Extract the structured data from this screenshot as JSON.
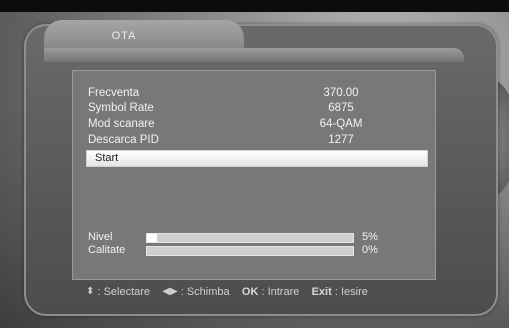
{
  "window": {
    "title": "OTA"
  },
  "fields": [
    {
      "label": "Frecventa",
      "value": "370.00"
    },
    {
      "label": "Symbol Rate",
      "value": "6875"
    },
    {
      "label": "Mod scanare",
      "value": "64-QAM"
    },
    {
      "label": "Descarca PID",
      "value": "1277"
    }
  ],
  "start": {
    "label": "Start"
  },
  "meters": {
    "nivel": {
      "label": "Nivel",
      "value_text": "5%",
      "level_percent": 5
    },
    "calitate": {
      "label": "Calitate",
      "value_text": "0%",
      "level_percent": 0
    }
  },
  "footer": {
    "select_icon": "up-down-arrows-icon",
    "select_label": ": Selectare",
    "change_icon": "left-right-arrows-icon",
    "change_label": ": Schimba",
    "ok_key": "OK",
    "ok_label": ": Intrare",
    "exit_key": "Exit",
    "exit_label": ": Iesire"
  },
  "colors": {
    "panel": "#787878",
    "highlight": "#ffffff",
    "text": "#f2f2f2"
  }
}
